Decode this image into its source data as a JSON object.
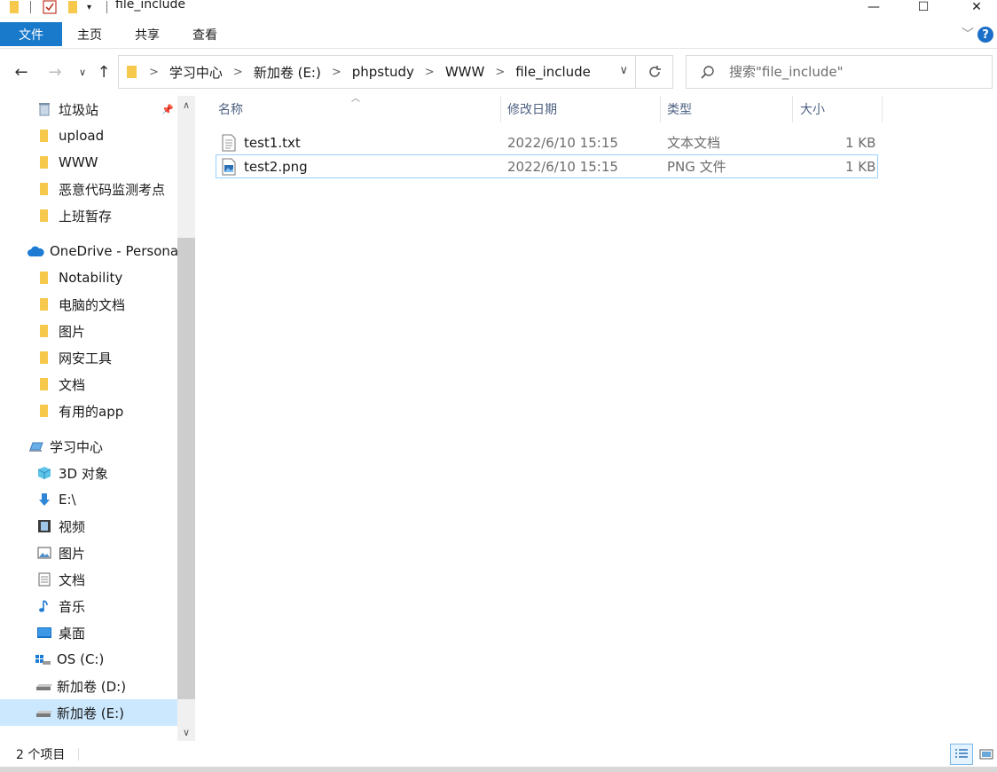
{
  "window": {
    "title": "file_include",
    "minimize": "—",
    "maximize": "☐",
    "close": "✕"
  },
  "ribbon": {
    "file_tab": "文件",
    "tabs": [
      "主页",
      "共享",
      "查看"
    ],
    "help": "?"
  },
  "address": {
    "crumbs": [
      "学习中心",
      "新加卷 (E:)",
      "phpstudy",
      "WWW",
      "file_include"
    ]
  },
  "search": {
    "placeholder": "搜索\"file_include\""
  },
  "nav": {
    "quick_access": [
      "垃圾站",
      "upload",
      "WWW",
      "恶意代码监测考点",
      "上班暂存"
    ],
    "onedrive": "OneDrive - Personal",
    "onedrive_items": [
      "Notability",
      "电脑的文档",
      "图片",
      "网安工具",
      "文档",
      "有用的app"
    ],
    "this_pc": "学习中心",
    "pc_items": [
      "3D 对象",
      "E:\\",
      "视频",
      "图片",
      "文档",
      "音乐",
      "桌面",
      "OS (C:)",
      "新加卷 (D:)",
      "新加卷 (E:)"
    ]
  },
  "columns": [
    "名称",
    "修改日期",
    "类型",
    "大小"
  ],
  "files": [
    {
      "name": "test1.txt",
      "modified": "2022/6/10 15:15",
      "type": "文本文档",
      "size": "1 KB"
    },
    {
      "name": "test2.png",
      "modified": "2022/6/10 15:15",
      "type": "PNG 文件",
      "size": "1 KB"
    }
  ],
  "status": {
    "count": "2 个项目"
  },
  "colors": {
    "accent": "#1979ca",
    "selection": "#cce8ff",
    "selection_border": "#99d1ff",
    "folder": "#f6c84c"
  }
}
